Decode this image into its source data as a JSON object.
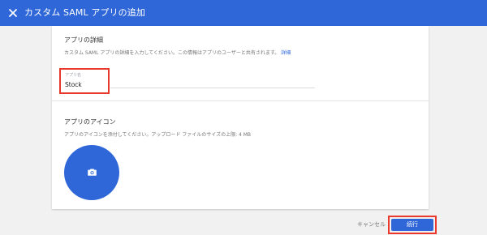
{
  "header": {
    "title": "カスタム SAML アプリの追加",
    "close_icon": "close-icon"
  },
  "app_details": {
    "heading": "アプリの詳細",
    "description": "カスタム SAML アプリの詳細を入力してください。この情報はアプリのユーザーと共有されます。",
    "details_link": "詳細",
    "app_name_label": "アプリ名",
    "app_name_value": "Stock"
  },
  "app_icon": {
    "heading": "アプリのアイコン",
    "description": "アプリのアイコンを添付してください。アップロード ファイルのサイズの上限: 4 MB",
    "upload_icon": "camera-icon"
  },
  "footer": {
    "cancel_label": "キャンセル",
    "continue_label": "続行"
  },
  "colors": {
    "accent": "#2f67d8",
    "highlight": "#e8392c"
  }
}
